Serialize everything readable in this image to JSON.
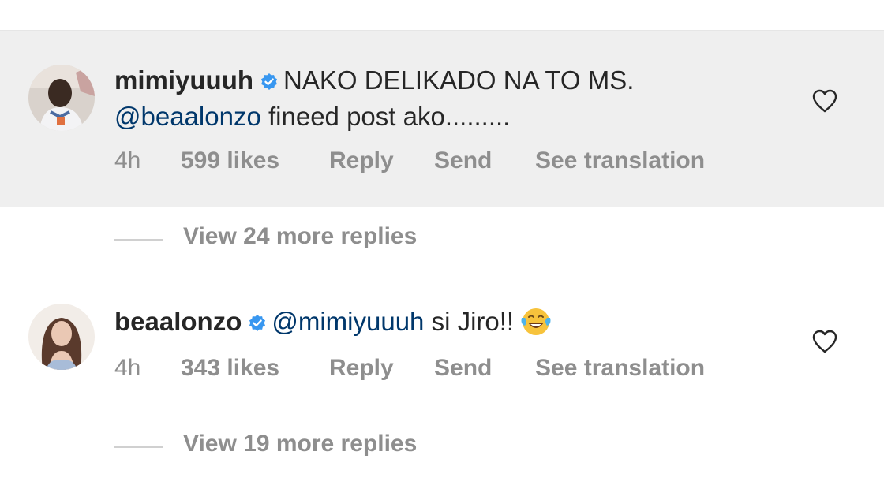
{
  "comments": [
    {
      "username": "mimiyuuuh",
      "text_prefix": "NAKO DELIKADO NA TO MS.",
      "mention": "@beaalonzo",
      "text_suffix": "fineed post ako.........",
      "time": "4h",
      "likes": "599 likes",
      "reply": "Reply",
      "send": "Send",
      "translate": "See translation",
      "view_replies": "View 24 more replies",
      "highlighted": true
    },
    {
      "username": "beaalonzo",
      "mention": "@mimiyuuuh",
      "text_suffix": "si Jiro!!",
      "emoji": "face-with-tears-of-joy",
      "time": "4h",
      "likes": "343 likes",
      "reply": "Reply",
      "send": "Send",
      "translate": "See translation",
      "view_replies": "View 19 more replies",
      "highlighted": false
    }
  ],
  "icons": {
    "verified": "verified-badge-icon",
    "like": "heart-outline-icon"
  },
  "colors": {
    "highlight_bg": "#efefef",
    "mention": "#00376b",
    "meta": "#8e8e8e",
    "verified": "#3897f0"
  }
}
